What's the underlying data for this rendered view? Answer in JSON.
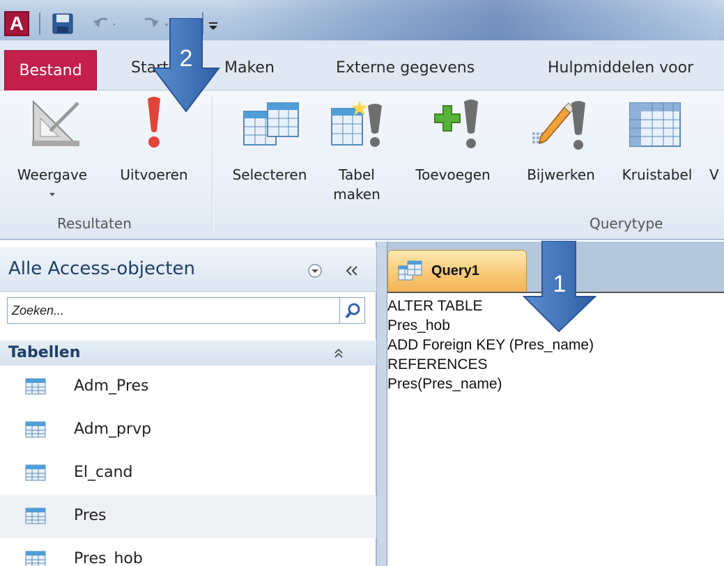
{
  "titlebar": {
    "app_icon_letter": "A",
    "accent": "#c21f4b"
  },
  "tabs": {
    "file": "Bestand",
    "items": [
      "Start",
      "Maken",
      "Externe gegevens",
      "Hulpmiddelen voor"
    ]
  },
  "ribbon": {
    "results_group": {
      "label": "Resultaten",
      "view": "Weergave",
      "run": "Uitvoeren"
    },
    "querytype_group": {
      "label": "Querytype",
      "select": "Selecteren",
      "make_table_1": "Tabel",
      "make_table_2": "maken",
      "append": "Toevoegen",
      "update": "Bijwerken",
      "crosstab": "Kruistabel",
      "cut": "V"
    }
  },
  "nav": {
    "title": "Alle Access-objecten",
    "search_placeholder": "Zoeken...",
    "category": "Tabellen",
    "items": [
      "Adm_Pres",
      "Adm_prvp",
      "El_cand",
      "Pres",
      "Pres_hob"
    ],
    "selected_item": "Pres"
  },
  "document": {
    "tab_label": "Query1",
    "sql_lines": [
      "ALTER TABLE",
      "Pres_hob",
      "ADD Foreign KEY (Pres_name)",
      "REFERENCES",
      "Pres(Pres_name)"
    ]
  },
  "annotations": {
    "arrow_1": "1",
    "arrow_2": "2",
    "arrow_color": "#3f73b8"
  }
}
